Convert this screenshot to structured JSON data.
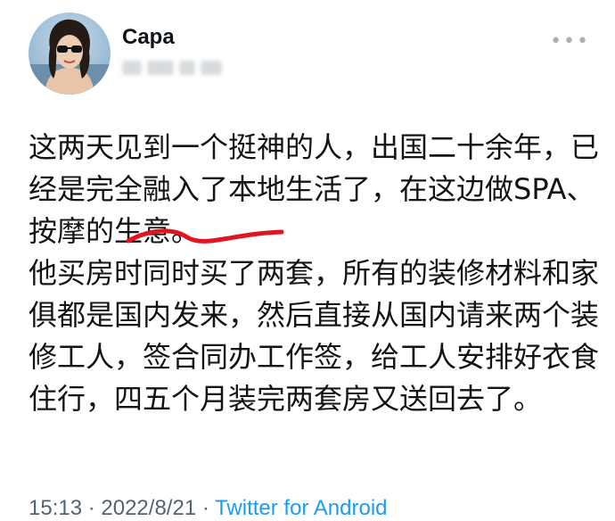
{
  "user": {
    "display_name": "Capa",
    "handle": "@▪▪_▪▪_▪"
  },
  "icons": {
    "more": "more-horizontal-icon"
  },
  "tweet": {
    "paragraph1": "这两天见到一个挺神的人，出国二十余年，已经是完全融入了本地生活了，在这边做SPA、按摩的生意。",
    "paragraph2": "他买房时同时买了两套，所有的装修材料和家俱都是国内发来，然后直接从国内请来两个装修工人，签合同办工作签，给工人安排好衣食住行，四五个月装完两套房又送回去了。"
  },
  "meta": {
    "time": "15:13",
    "sep1": " · ",
    "date": "2022/8/21",
    "sep2": " · ",
    "source": "Twitter for Android"
  },
  "colors": {
    "link": "#1d9bf0",
    "muted": "#536471",
    "scribble": "#e0161f"
  }
}
